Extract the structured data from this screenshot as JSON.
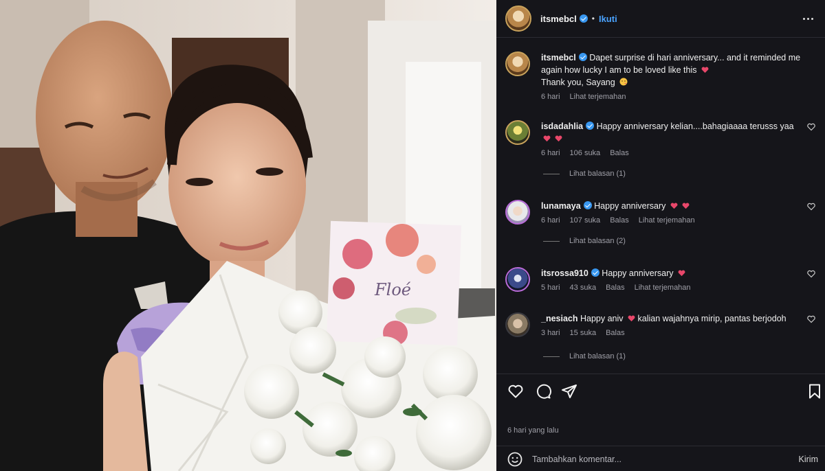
{
  "post": {
    "username": "itsmebcl",
    "follow_label": "Ikuti",
    "more_icon": "more-horizontal-icon"
  },
  "caption": {
    "username": "itsmebcl",
    "text": "Dapet surprise di hari anniversary... and it reminded me again how lucky I am to be loved like this",
    "text2": "Thank you, Sayang",
    "time": "6 hari",
    "translate": "Lihat terjemahan"
  },
  "comments": [
    {
      "username": "isdadahlia",
      "verified": true,
      "text": "Happy anniversary kelian....bahagiaaaa terusss yaa",
      "time": "6 hari",
      "likes": "106 suka",
      "reply": "Balas",
      "translate": "",
      "view_replies": "Lihat balasan (1)"
    },
    {
      "username": "lunamaya",
      "verified": true,
      "text": "Happy anniversary",
      "time": "6 hari",
      "likes": "107 suka",
      "reply": "Balas",
      "translate": "Lihat terjemahan",
      "view_replies": "Lihat balasan (2)"
    },
    {
      "username": "itsrossa910",
      "verified": true,
      "text": "Happy anniversary",
      "time": "5 hari",
      "likes": "43 suka",
      "reply": "Balas",
      "translate": "Lihat terjemahan",
      "view_replies": ""
    },
    {
      "username": "_nesiach",
      "verified": false,
      "text": "Happy aniv",
      "text2": "kalian wajahnya mirip, pantas berjodoh",
      "time": "3 hari",
      "likes": "15 suka",
      "reply": "Balas",
      "translate": "",
      "view_replies": "Lihat balasan (1)"
    }
  ],
  "actions": {
    "like_icon": "heart-icon",
    "comment_icon": "comment-icon",
    "share_icon": "send-icon",
    "save_icon": "bookmark-icon"
  },
  "timestamp": "6 hari yang lalu",
  "composer": {
    "placeholder": "Tambahkan komentar...",
    "send_label": "Kirim",
    "emoji_icon": "smiley-icon"
  },
  "photo": {
    "card_text": "Floé"
  },
  "colors": {
    "panel_bg": "#15151a",
    "link": "#4aa3ff",
    "verified": "#3897f0",
    "heart": "#e8476a"
  }
}
